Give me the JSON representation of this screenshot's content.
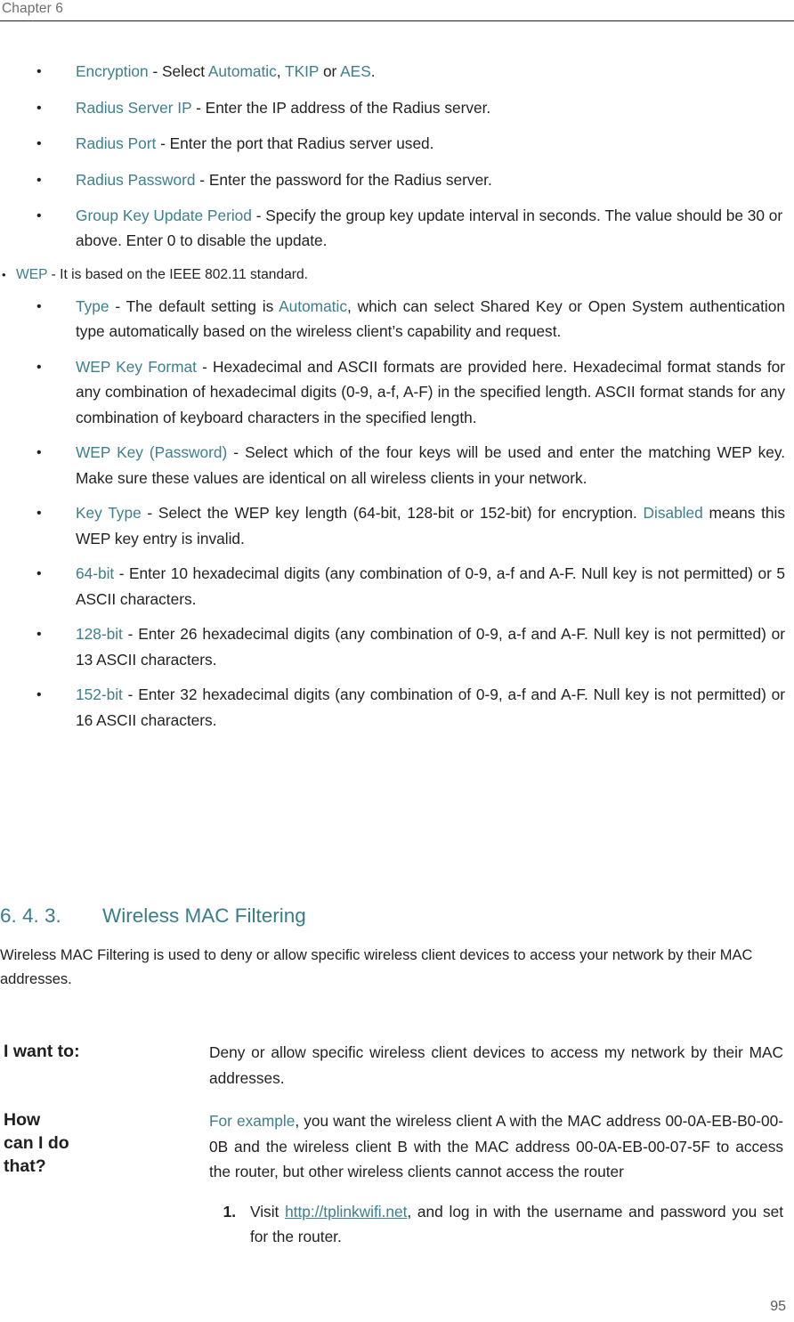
{
  "header": {
    "chapter": "Chapter 6"
  },
  "wpa_bullets": [
    {
      "term": "Encryption",
      "parts": [
        {
          "t": " - Select ",
          "tint": false
        },
        {
          "t": "Automatic",
          "tint": true
        },
        {
          "t": ", ",
          "tint": false
        },
        {
          "t": "TKIP",
          "tint": true
        },
        {
          "t": " or ",
          "tint": false
        },
        {
          "t": "AES",
          "tint": true
        },
        {
          "t": ".",
          "tint": false
        }
      ]
    },
    {
      "term": "Radius Server IP",
      "parts": [
        {
          "t": " - Enter the IP address of the Radius server.",
          "tint": false
        }
      ]
    },
    {
      "term": "Radius Port",
      "parts": [
        {
          "t": " - Enter the port that Radius server used.",
          "tint": false
        }
      ]
    },
    {
      "term": "Radius Password",
      "parts": [
        {
          "t": " - Enter the password for the Radius server.",
          "tint": false
        }
      ]
    },
    {
      "term": "Group Key Update Period",
      "parts": [
        {
          "t": " - Specify the group key update interval in seconds. The value should be 30 or above. Enter 0 to disable the update.",
          "tint": false
        }
      ]
    }
  ],
  "wep": {
    "term": "WEP",
    "desc": " - It is based on the IEEE 802.11 standard."
  },
  "wep_bullets": [
    {
      "term": "Type",
      "parts": [
        {
          "t": " - The default setting is ",
          "tint": false
        },
        {
          "t": "Automatic",
          "tint": true
        },
        {
          "t": ", which can select Shared Key or Open System authentication type automatically based on the wireless client’s capability and request.",
          "tint": false
        }
      ]
    },
    {
      "term": "WEP Key Format",
      "parts": [
        {
          "t": " - Hexadecimal and ASCII formats are provided here. Hexadecimal format stands for any combination of hexadecimal digits (0-9, a-f, A-F) in the specified length. ASCII format stands for any combination of keyboard characters in the specified length.",
          "tint": false
        }
      ]
    },
    {
      "term": "WEP Key (Password)",
      "parts": [
        {
          "t": " - Select which of the four keys will be used and enter the matching WEP key. Make sure these values are identical on all wireless clients in your network.",
          "tint": false
        }
      ]
    },
    {
      "term": "Key Type",
      "parts": [
        {
          "t": " - Select the WEP key length (64-bit, 128-bit or 152-bit) for encryption. ",
          "tint": false
        },
        {
          "t": "Disabled",
          "tint": true
        },
        {
          "t": " means this WEP key entry is invalid.",
          "tint": false
        }
      ]
    },
    {
      "term": "64-bit",
      "parts": [
        {
          "t": " - Enter 10 hexadecimal digits (any combination of 0-9, a-f and A-F. Null key is not permitted) or 5 ASCII characters.",
          "tint": false
        }
      ]
    },
    {
      "term": "128-bit",
      "parts": [
        {
          "t": " - Enter 26 hexadecimal digits (any combination of 0-9, a-f and A-F. Null key is not permitted) or 13 ASCII characters.",
          "tint": false
        }
      ]
    },
    {
      "term": "152-bit",
      "parts": [
        {
          "t": " - Enter 32 hexadecimal digits (any combination of 0-9, a-f and A-F. Null key is not permitted) or 16 ASCII characters.",
          "tint": false
        }
      ]
    }
  ],
  "section": {
    "number": "6. 4. 3.",
    "title": "Wireless MAC Filtering",
    "intro": "Wireless MAC Filtering is used to deny or allow specific wireless client devices to access your network by their MAC addresses."
  },
  "qa": {
    "want_label": "I want to:",
    "want_body": "Deny or allow specific wireless client devices to access my network by their MAC addresses.",
    "how_label": "How can I do that?",
    "how_intro_tint": "For example",
    "how_body": ", you want the wireless client A with the MAC address 00-0A-EB-B0-00-0B and the wireless client B with the MAC address 00-0A-EB-00-07-5F to access the router, but other wireless clients cannot access the router",
    "steps": [
      {
        "num": "1.",
        "pre": "Visit ",
        "link": "http://tplinkwifi.net",
        "post": ", and log in with the username and password you set for the router."
      }
    ]
  },
  "footer": {
    "page_number": "95"
  }
}
